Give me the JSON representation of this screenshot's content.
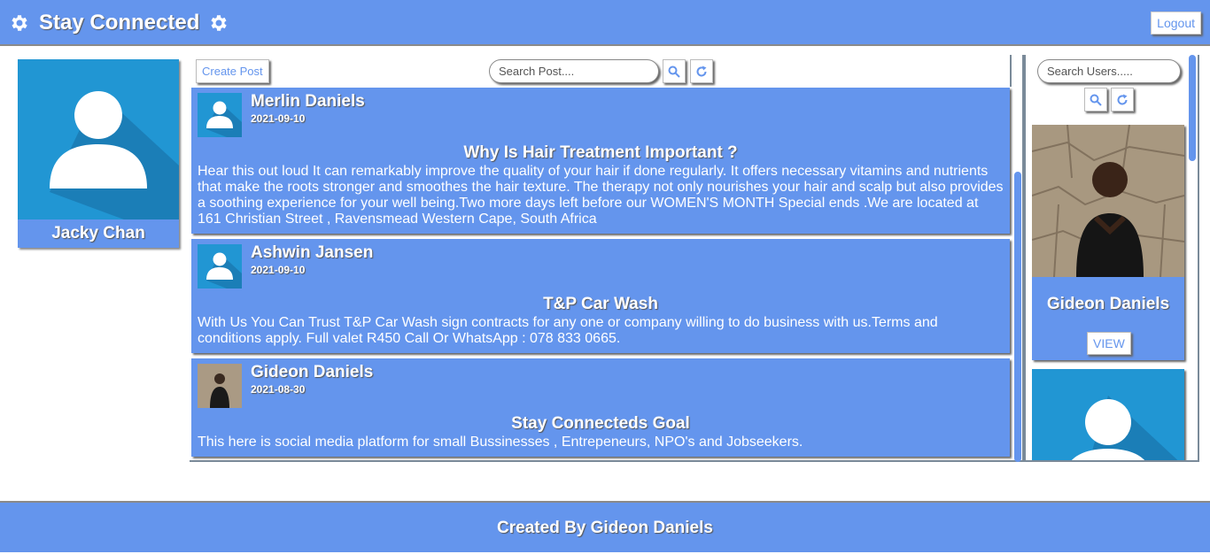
{
  "header": {
    "title": "Stay Connected",
    "logout_label": "Logout",
    "left_icon": "gear-icon",
    "right_icon": "gear-icon"
  },
  "profile": {
    "name": "Jacky Chan",
    "avatar_icon": "default-user-avatar"
  },
  "feed": {
    "create_post_label": "Create Post",
    "search_placeholder": "Search Post....",
    "search_icon": "search-icon",
    "refresh_icon": "refresh-icon",
    "posts": [
      {
        "author": "Merlin Daniels",
        "date": "2021-09-10",
        "title": "Why Is Hair Treatment Important ?",
        "body": "Hear this out loud It can remarkably improve the quality of your hair if done regularly. It offers necessary vitamins and nutrients that make the roots stronger and smoothes the hair texture. The therapy not only nourishes your hair and scalp but also provides a soothing experience for your well being.Two more days left before our WOMEN'S MONTH Special ends .We are located at 161 Christian Street , Ravensmead Western Cape, South Africa",
        "avatar": "default-user-avatar"
      },
      {
        "author": "Ashwin Jansen",
        "date": "2021-09-10",
        "title": "T&P Car Wash",
        "body": "With Us You Can Trust T&P Car Wash sign contracts for any one or company willing to do business with us.Terms and conditions apply. Full valet R450 Call Or WhatsApp : 078 833 0665.",
        "avatar": "default-user-avatar"
      },
      {
        "author": "Gideon Daniels",
        "date": "2021-08-30",
        "title": "Stay Connecteds Goal",
        "body": "This here is social media platform for small Bussinesses , Entrepeneurs, NPO's and Jobseekers.",
        "avatar": "user-photo"
      }
    ]
  },
  "users": {
    "search_placeholder": "Search Users.....",
    "list": [
      {
        "name": "Gideon Daniels",
        "view_label": "VIEW",
        "avatar": "user-photo"
      },
      {
        "name": "",
        "view_label": "",
        "avatar": "default-user-avatar"
      }
    ]
  },
  "footer": {
    "text": "Created By Gideon Daniels"
  },
  "colors": {
    "primary": "#6495ed",
    "avatar_bg": "#2196d3",
    "white": "#ffffff"
  }
}
